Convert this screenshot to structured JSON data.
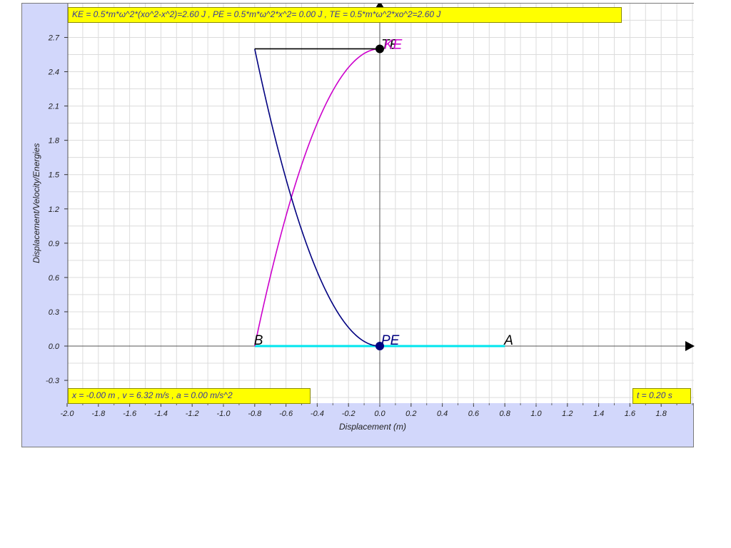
{
  "info": {
    "energy_text": "KE = 0.5*m*ω^2*(xo^2-x^2)=2.60 J , PE = 0.5*m*ω^2*x^2= 0.00 J , TE = 0.5*m*ω^2*xo^2=2.60 J",
    "motion_text": "x = -0.00 m , v = 6.32 m/s , a = 0.00 m/s^2",
    "time_text": "t = 0.20 s"
  },
  "point_labels": {
    "a": "A",
    "b": "B",
    "pe": "PE",
    "ke": "KE",
    "te": "TE"
  },
  "colors": {
    "background": "#d2d7fb",
    "plot_background": "#ffffff",
    "grid": "#dcdcdc",
    "ke_curve": "#cc00cc",
    "pe_curve": "#000080",
    "te_line": "#000000",
    "oscillation_path": "#00e5ee",
    "info_box": "#ffff00"
  },
  "chart_data": {
    "type": "line",
    "xlabel": "Displacement (m)",
    "ylabel": "Displacement/Velocity/Energies",
    "xlim": [
      -2.0,
      2.0
    ],
    "ylim": [
      -0.3,
      2.9
    ],
    "x_ticks": [
      "-2.0",
      "-1.8",
      "-1.6",
      "-1.4",
      "-1.2",
      "-1.0",
      "-0.8",
      "-0.6",
      "-0.4",
      "-0.2",
      "0.0",
      "0.2",
      "0.4",
      "0.6",
      "0.8",
      "1.0",
      "1.2",
      "1.4",
      "1.6",
      "1.8"
    ],
    "y_ticks": [
      "-0.3",
      "0.0",
      "0.3",
      "0.6",
      "0.9",
      "1.2",
      "1.5",
      "1.8",
      "2.1",
      "2.4",
      "2.7"
    ],
    "amplitude": 0.8,
    "total_energy": 2.6,
    "current_x": 0.0,
    "series": [
      {
        "name": "KE",
        "x": [
          -0.8,
          -0.7,
          -0.6,
          -0.5,
          -0.4,
          -0.3,
          -0.2,
          -0.1,
          0.0
        ],
        "y": [
          0.0,
          0.61,
          1.14,
          1.58,
          1.95,
          2.23,
          2.44,
          2.56,
          2.6
        ]
      },
      {
        "name": "PE",
        "x": [
          -0.8,
          -0.7,
          -0.6,
          -0.5,
          -0.4,
          -0.3,
          -0.2,
          -0.1,
          0.0
        ],
        "y": [
          2.6,
          1.99,
          1.46,
          1.02,
          0.65,
          0.37,
          0.16,
          0.04,
          0.0
        ]
      },
      {
        "name": "TE",
        "x": [
          -0.8,
          0.0
        ],
        "y": [
          2.6,
          2.6
        ]
      }
    ],
    "oscillation_range": [
      -0.8,
      0.8
    ]
  }
}
